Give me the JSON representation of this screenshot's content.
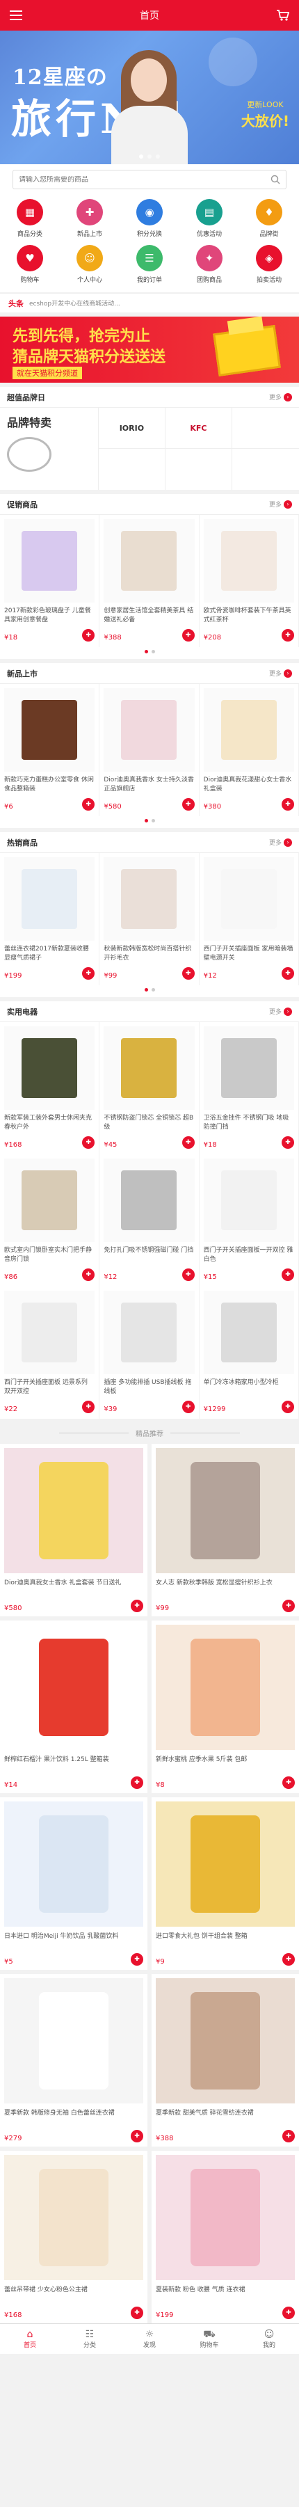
{
  "header": {
    "title": "首页"
  },
  "banner": {
    "line1": "12星座の",
    "line2": "旅行N记",
    "promo_small": "更新LOOK",
    "promo_big": "大放价!"
  },
  "search": {
    "placeholder": "请输入您所需要的商品"
  },
  "nav": [
    {
      "label": "商品分类",
      "icon": "grid-icon",
      "color": "#e8112d",
      "glyph": "▦"
    },
    {
      "label": "新品上市",
      "icon": "tag-icon",
      "color": "#e0467a",
      "glyph": "✚"
    },
    {
      "label": "积分兑换",
      "icon": "coin-icon",
      "color": "#2f7de0",
      "glyph": "◉"
    },
    {
      "label": "优惠活动",
      "icon": "coupon-icon",
      "color": "#18a08f",
      "glyph": "▤"
    },
    {
      "label": "品牌街",
      "icon": "brand-icon",
      "color": "#f39c12",
      "glyph": "♦"
    },
    {
      "label": "购物车",
      "icon": "cart-icon",
      "color": "#e8112d",
      "glyph": "♥"
    },
    {
      "label": "个人中心",
      "icon": "user-icon",
      "color": "#f1a917",
      "glyph": "☺"
    },
    {
      "label": "我的订单",
      "icon": "order-icon",
      "color": "#3dba6b",
      "glyph": "☰"
    },
    {
      "label": "团购商品",
      "icon": "group-icon",
      "color": "#e0467a",
      "glyph": "✦"
    },
    {
      "label": "拍卖活动",
      "icon": "auction-icon",
      "color": "#e8112d",
      "glyph": "◈"
    }
  ],
  "ticker": {
    "tag": "头条",
    "text": "ecshop开发中心在线商城活动..."
  },
  "ad": {
    "line1": "先到先得，抢完为止",
    "line2": "猜品牌天猫积分送送送",
    "line3": "就在天猫积分频道"
  },
  "brand": {
    "section_title": "超值品牌日",
    "more": "更多",
    "left_title": "品牌特卖",
    "cells": [
      {
        "name": "IORIO",
        "color": "#333"
      },
      {
        "name": "KFC",
        "color": "#c8102e"
      },
      {
        "name": "",
        "color": "#999"
      },
      {
        "name": "",
        "color": "#999"
      },
      {
        "name": "",
        "color": "#999"
      },
      {
        "name": "",
        "color": "#999"
      }
    ]
  },
  "promo": {
    "title": "促销商品",
    "more": "更多",
    "items": [
      {
        "name": "2017新款彩色玻璃盘子 儿童餐具家用创意餐盘",
        "price": "18"
      },
      {
        "name": "创意家居生活馆全套精美茶具 结婚送礼必备",
        "price": "388"
      },
      {
        "name": "欧式骨瓷咖啡杯套装下午茶具英式红茶杯",
        "price": "208"
      }
    ]
  },
  "newp": {
    "title": "新品上市",
    "more": "更多",
    "items": [
      {
        "name": "新款巧克力蛋糕办公室零食 休闲食品整箱装",
        "price": "6"
      },
      {
        "name": "Dior迪奥真我香水 女士持久淡香 正品旗舰店",
        "price": "580"
      },
      {
        "name": "Dior迪奥真我花漾甜心女士香水 礼盒装",
        "price": "380"
      }
    ]
  },
  "hot": {
    "title": "热销商品",
    "more": "更多",
    "items": [
      {
        "name": "蕾丝连衣裙2017新款夏装收腰显瘦气质裙子",
        "price": "199"
      },
      {
        "name": "秋装新款韩版宽松时尚百搭针织开衫毛衣",
        "price": "99"
      },
      {
        "name": "西门子开关插座面板 家用暗装墙壁电源开关",
        "price": "12"
      }
    ]
  },
  "tools": {
    "title": "实用电器",
    "more": "更多",
    "items": [
      {
        "name": "新款军装工装外套男士休闲夹克春秋户外",
        "price": "168"
      },
      {
        "name": "不锈钢防盗门锁芯 全铜锁芯 超B级",
        "price": "45"
      },
      {
        "name": "卫浴五金挂件 不锈钢门吸 地吸 防撞门挡",
        "price": "18"
      },
      {
        "name": "欧式室内门锁卧室实木门把手静音房门锁",
        "price": "86"
      },
      {
        "name": "免打孔门吸不锈钢强磁门碰 门挡",
        "price": "12"
      },
      {
        "name": "西门子开关插座面板一开双控 雅白色",
        "price": "15"
      },
      {
        "name": "西门子开关插座面板 远景系列 双开双控",
        "price": "22"
      },
      {
        "name": "插座 多功能排插 USB插线板 拖线板",
        "price": "39"
      },
      {
        "name": "单门冷冻冰箱家用小型冷柜",
        "price": "1299"
      }
    ]
  },
  "divider": "精品推荐",
  "recommend": [
    {
      "name": "Dior迪奥真我女士香水 礼盒套装 节日送礼",
      "price": "580"
    },
    {
      "name": "女人志 新款秋季韩版 宽松显瘦针织衫上衣",
      "price": "99"
    },
    {
      "name": "鲜榨红石榴汁 果汁饮料 1.25L 整箱装",
      "price": "14"
    },
    {
      "name": "新鲜水蜜桃 应季水果 5斤装 包邮",
      "price": "8"
    },
    {
      "name": "日本进口 明治Meiji 牛奶饮品 乳酸菌饮料",
      "price": "5"
    },
    {
      "name": "进口零食大礼包 饼干组合装 整箱",
      "price": "9"
    },
    {
      "name": "夏季新款 韩版修身无袖 白色蕾丝连衣裙",
      "price": "279"
    },
    {
      "name": "夏季新款 甜美气质 碎花雪纺连衣裙",
      "price": "388"
    },
    {
      "name": "蕾丝吊带裙 少女心粉色公主裙",
      "price": "168"
    },
    {
      "name": "夏装新款 粉色 收腰 气质 连衣裙",
      "price": "199"
    }
  ],
  "tabbar": [
    {
      "label": "首页",
      "icon": "home-icon",
      "glyph": "⌂",
      "active": true
    },
    {
      "label": "分类",
      "icon": "category-icon",
      "glyph": "☷",
      "active": false
    },
    {
      "label": "发现",
      "icon": "discover-icon",
      "glyph": "☼",
      "active": false
    },
    {
      "label": "购物车",
      "icon": "cart-icon",
      "glyph": "⛟",
      "active": false
    },
    {
      "label": "我的",
      "icon": "user-icon",
      "glyph": "☺",
      "active": false
    }
  ],
  "currency": "¥"
}
